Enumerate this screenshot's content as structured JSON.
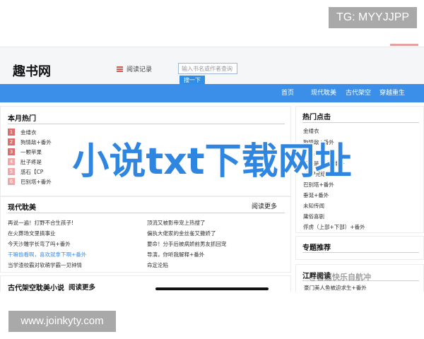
{
  "tg_tag": "TG: MYYJJPP",
  "url_tag": "www.joinkyty.com",
  "site": {
    "logo": "趣书网",
    "history_label": "阅读记录",
    "search_placeholder": "输入书名或作者查询",
    "search_button": "搜一下"
  },
  "nav": [
    "首页",
    "现代耽美",
    "古代架空",
    "穿越重生"
  ],
  "monthly_hot": {
    "title": "本月热门",
    "items": [
      {
        "rank": "1",
        "title": "金缕衣"
      },
      {
        "rank": "2",
        "title": "狗情敌+番外"
      },
      {
        "rank": "3",
        "title": "一颗苹果"
      },
      {
        "rank": "4",
        "title": "肚子疼是"
      },
      {
        "rank": "5",
        "title": "惑石【CP"
      },
      {
        "rank": "6",
        "title": "巴别塔+番外"
      }
    ]
  },
  "modern": {
    "title": "现代耽美",
    "more": "阅读更多",
    "left": [
      "再说一遍！打野不合生孩子!",
      "在火葬场文里搞事业",
      "今天沙雕学长弯了吗+番外",
      "干嘛偷看啊，喜欢就拿下啊+番外",
      "当学渣校霸对软萌学霸一见钟情"
    ],
    "right": [
      "顶流又被影帝宠上热搜了",
      "偏执大佬家的金丝雀又撒娇了",
      "要命！分手后被病娇前男友抓回宠",
      "导演，你听我解释+番外",
      "命定沦陷"
    ]
  },
  "ancient": {
    "title": "古代架空耽美小说",
    "more": "阅读更多"
  },
  "hot_click": {
    "title": "热门点击",
    "items": [
      "金缕衣",
      "狗情敌+番外",
      "颗苹果",
      "子疼是真的+番外",
      "【CP完结+番外】",
      "巴别塔+番外",
      "垂涎+番外",
      "未知传闻",
      "庸俗喜剧",
      "俘虏（上部+下部）+番外"
    ]
  },
  "topic": {
    "title": "专题推荐"
  },
  "more_section": {
    "title": "江畔阅读",
    "first_item": "豪门美人鱼被迫求生+番外"
  },
  "overlay": {
    "headline": "小说txt下载网址",
    "watermark": "@喜嘉快乐自航冲"
  }
}
